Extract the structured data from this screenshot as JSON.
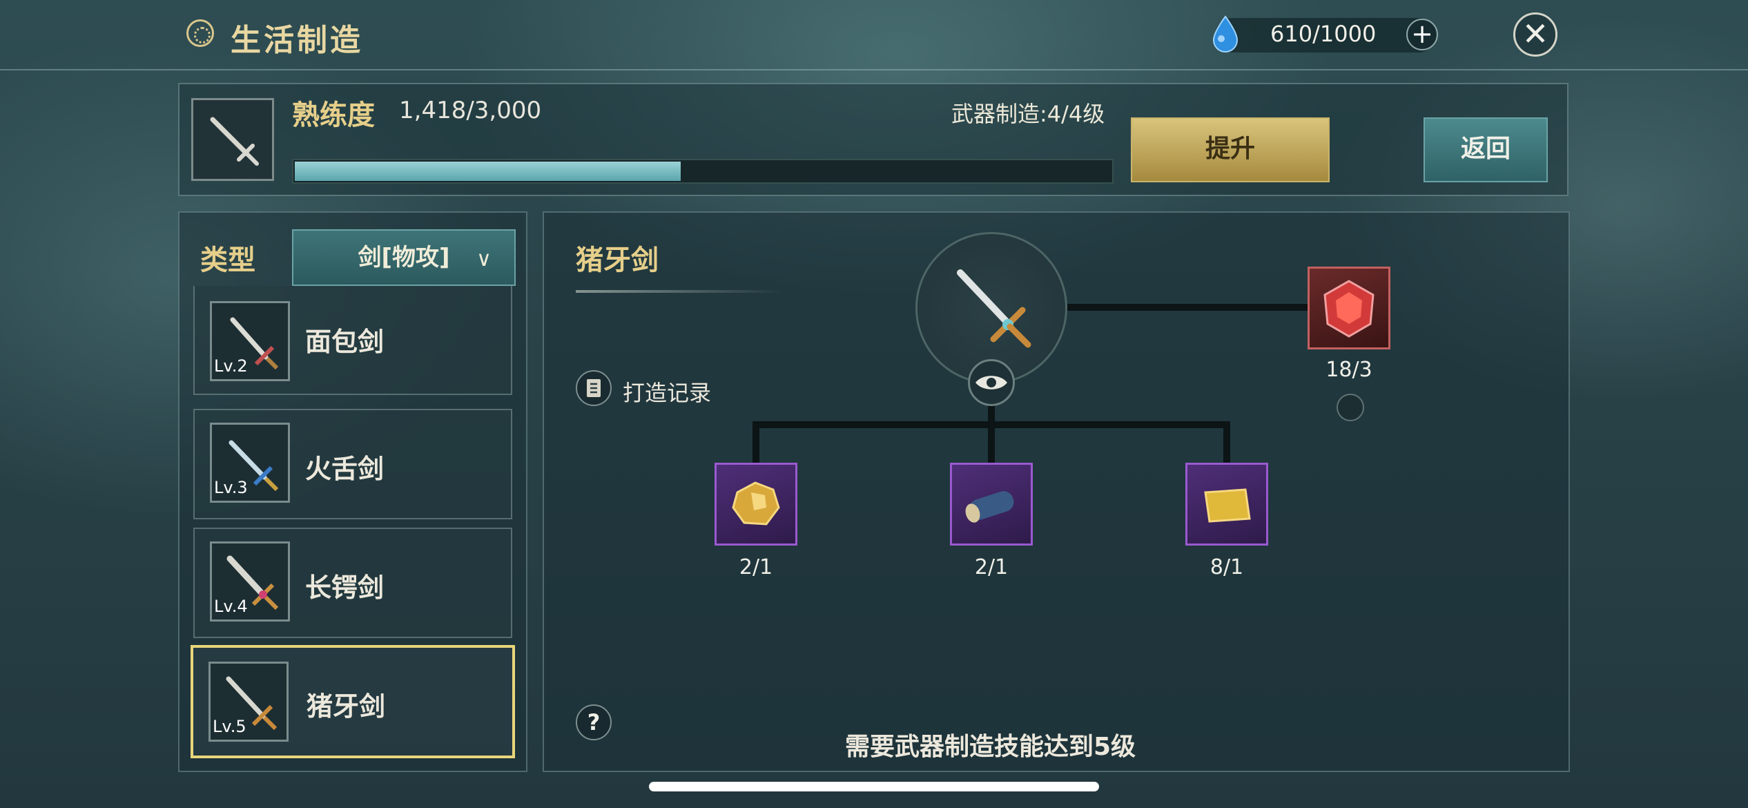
{
  "header": {
    "title": "生活制造",
    "resource_value": "610/1000",
    "plus_label": "+",
    "close_label": "✕"
  },
  "proficiency": {
    "label": "熟练度",
    "value": "1,418/3,000",
    "progress": 0.473,
    "weapon_level_text": "武器制造:4/4级",
    "upgrade_label": "提升",
    "return_label": "返回"
  },
  "filter": {
    "label": "类型",
    "selected": "剑[物攻]"
  },
  "recipe_list": [
    {
      "name": "面包剑",
      "level": "Lv.2",
      "selected": false
    },
    {
      "name": "火舌剑",
      "level": "Lv.3",
      "selected": false
    },
    {
      "name": "长锷剑",
      "level": "Lv.4",
      "selected": false
    },
    {
      "name": "猪牙剑",
      "level": "Lv.5",
      "selected": true
    }
  ],
  "detail": {
    "item_name": "猪牙剑",
    "record_label": "打造记录",
    "help_label": "?",
    "requirement_text": "需要武器制造技能达到5级",
    "materials": [
      {
        "count": "2/1",
        "icon": "gold-ore-icon"
      },
      {
        "count": "2/1",
        "icon": "wood-log-icon"
      },
      {
        "count": "8/1",
        "icon": "gold-sheet-icon"
      }
    ],
    "catalyst": {
      "count": "18/3",
      "icon": "red-gem-icon"
    }
  },
  "colors": {
    "accent_gold": "#e6cf8a",
    "progress_fill": "#7fc3c8",
    "material_border": "#9a5ad0",
    "selected_border": "#e8d67a"
  }
}
